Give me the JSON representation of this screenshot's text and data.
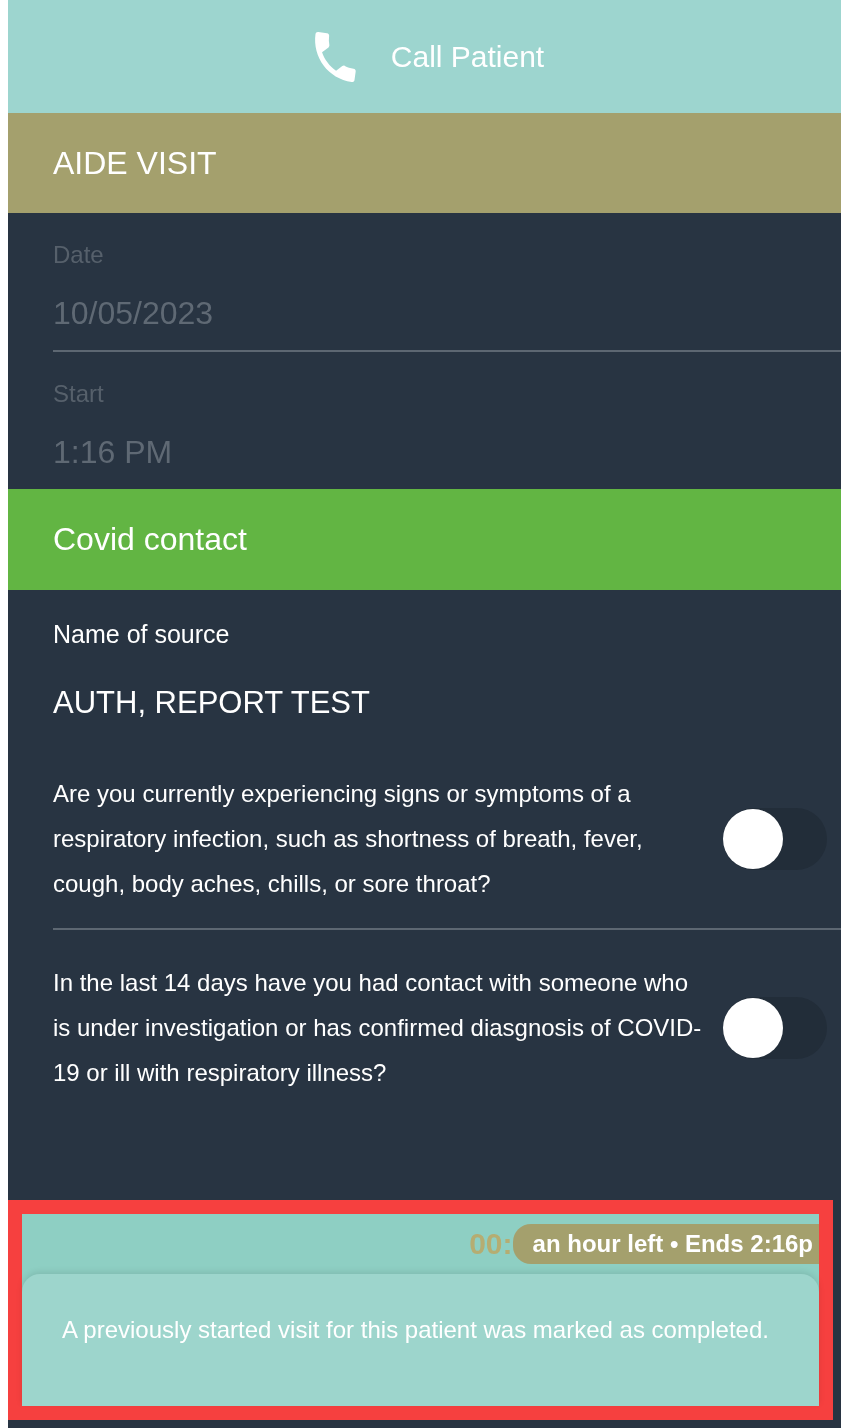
{
  "call_bar": {
    "label": "Call Patient"
  },
  "visit_header": {
    "title": "AIDE VISIT"
  },
  "visit_fields": [
    {
      "label": "Date",
      "value": "10/05/2023"
    },
    {
      "label": "Start",
      "value": "1:16 PM"
    }
  ],
  "section": {
    "title": "Covid contact"
  },
  "source": {
    "label": "Name of source",
    "value": "AUTH, REPORT TEST"
  },
  "questions": [
    {
      "text": "Are you currently experiencing signs or symptoms of a respiratory infection, such as shortness of breath, fever, cough, body aches, chills, or sore throat?",
      "on": false
    },
    {
      "text": "In the last 14 days have you had contact with someone who is under investigation or has confirmed diasgnosis of COVID-19 or ill with respiratory illness?",
      "on": false
    }
  ],
  "timer": {
    "time": "00:",
    "remaining": "an hour left • Ends 2:16p"
  },
  "toast": {
    "message": "A previously started visit for this patient was marked as completed."
  }
}
